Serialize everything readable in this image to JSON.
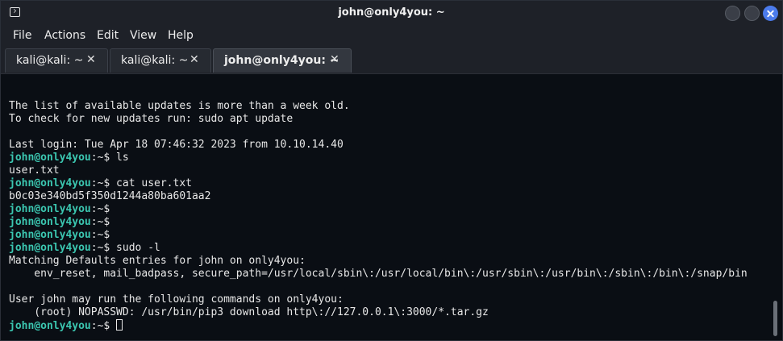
{
  "window": {
    "title": "john@only4you: ~"
  },
  "menu": [
    "File",
    "Actions",
    "Edit",
    "View",
    "Help"
  ],
  "tabs": [
    {
      "label": "kali@kali: ~",
      "close": "✕"
    },
    {
      "label": "kali@kali: ~",
      "close": "✕"
    },
    {
      "label": "john@only4you: ~",
      "close": "✕"
    }
  ],
  "terminal": {
    "prompt_user": "john@only4you",
    "prompt_suffix": ":~$",
    "lines": [
      "The list of available updates is more than a week old.",
      "To check for new updates run: sudo apt update",
      "Last login: Tue Apr 18 07:46:32 2023 from 10.10.14.40",
      "user.txt",
      "b0c03e340bd5f350d1244a80ba601aa2",
      "Matching Defaults entries for john on only4you:",
      "    env_reset, mail_badpass, secure_path=/usr/local/sbin\\:/usr/local/bin\\:/usr/sbin\\:/usr/bin\\:/sbin\\:/bin\\:/snap/bin",
      "User john may run the following commands on only4you:",
      "    (root) NOPASSWD: /usr/bin/pip3 download http\\://127.0.0.1\\:3000/*.tar.gz"
    ],
    "commands": [
      " ls",
      " cat user.txt",
      "",
      "",
      "",
      " sudo -l",
      " "
    ]
  },
  "colors": {
    "prompt": "#3bc6b0",
    "close_button": "#4b7bec",
    "background": "#0a0e14"
  }
}
